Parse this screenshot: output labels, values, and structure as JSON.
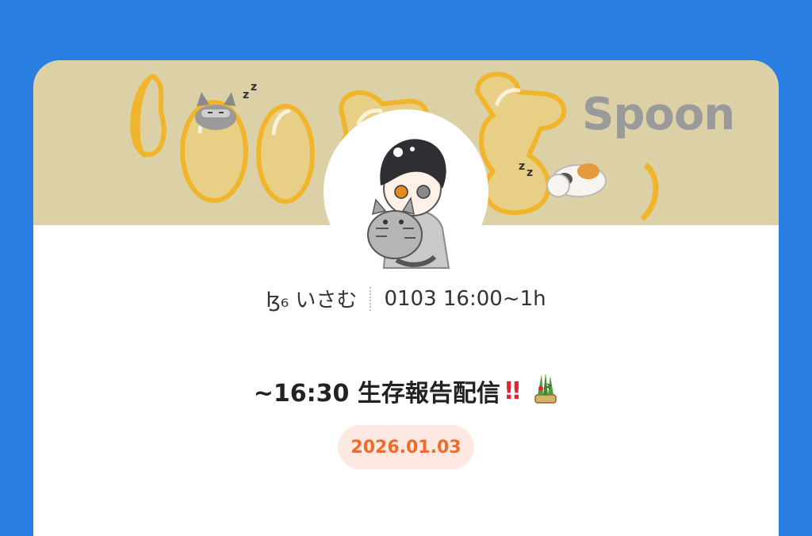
{
  "banner": {
    "brand": "Spoon",
    "colors": {
      "background": "#dcd0a6",
      "balloon_fill": "#e8cf86",
      "balloon_stroke": "#f0b52b"
    }
  },
  "profile": {
    "avatar_icon": "anime-boy-with-cat-avatar",
    "name": "ɮ₆ いさむ",
    "schedule": "0103 16:00~1h"
  },
  "post": {
    "title": "~16:30 生存報告配信",
    "title_marks": "!!",
    "title_emoji": "kadomatsu-icon",
    "date": "2026.01.03"
  },
  "colors": {
    "page_bg": "#2a7de1",
    "date_pill_bg": "#fde9e1",
    "date_text": "#ef6a2c",
    "exclamation": "#e0262e"
  }
}
